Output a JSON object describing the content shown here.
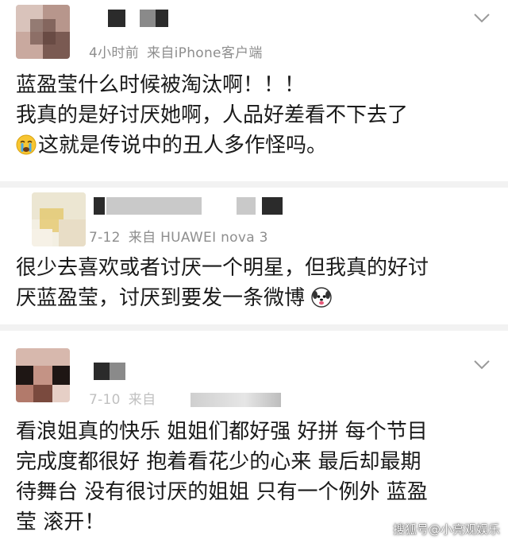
{
  "comments": [
    {
      "time": "4小时前",
      "source": "来自iPhone客户端",
      "lines": [
        "蓝盈莹什么时候被淘汰啊！！！",
        "我真的是好讨厌她啊，人品好差看不下去了",
        "这就是传说中的丑人多作怪吗。"
      ],
      "line3_emoji": "crying-face-icon"
    },
    {
      "time": "7-12",
      "source": "来自 HUAWEI nova 3",
      "lines": [
        "很少去喜欢或者讨厌一个明星，但我真的好讨",
        "厌蓝盈莹，讨厌到要发一条微博"
      ],
      "trailing_emoji": "dog-face-icon"
    },
    {
      "time": "7-10",
      "source": "来自",
      "lines": [
        "看浪姐真的快乐 姐姐们都好强 好拼 每个节目",
        "完成度都很好 抱着看花少的心来 最后却最期",
        "待舞台 没有很讨厌的姐姐 只有一个例外 蓝盈",
        "莹 滚开！"
      ]
    }
  ],
  "watermark": "搜狐号@小亮观娱乐",
  "colors": {
    "text": "#1a1a1a",
    "meta": "#8e8e8e",
    "separator": "#f2f2f2"
  }
}
